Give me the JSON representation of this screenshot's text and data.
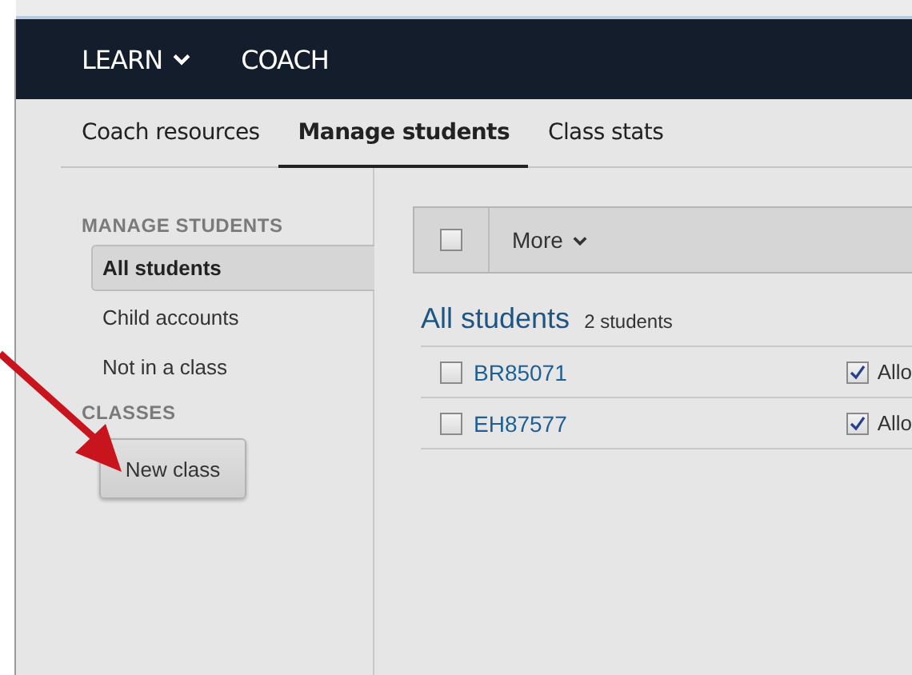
{
  "nav": [
    {
      "label": "LEARN",
      "dropdown": true
    },
    {
      "label": "COACH",
      "dropdown": false
    }
  ],
  "subtabs": [
    {
      "label": "Coach resources",
      "selected": false
    },
    {
      "label": "Manage students",
      "selected": true
    },
    {
      "label": "Class stats",
      "selected": false
    }
  ],
  "sidebar": {
    "sections": [
      {
        "heading": "MANAGE STUDENTS",
        "items": [
          {
            "label": "All students",
            "selected": true
          },
          {
            "label": "Child accounts",
            "selected": false
          },
          {
            "label": "Not in a class",
            "selected": false
          }
        ]
      },
      {
        "heading": "CLASSES"
      }
    ],
    "button": "New class"
  },
  "toolbar": {
    "select_all_checked": false,
    "menu": "More"
  },
  "list": {
    "title": "All students",
    "count": "2 students",
    "rows": [
      {
        "name": "BR85071",
        "checked": false,
        "allow_checked": true,
        "allow_label": "Allo"
      },
      {
        "name": "EH87577",
        "checked": false,
        "allow_checked": true,
        "allow_label": "Allo"
      }
    ]
  }
}
